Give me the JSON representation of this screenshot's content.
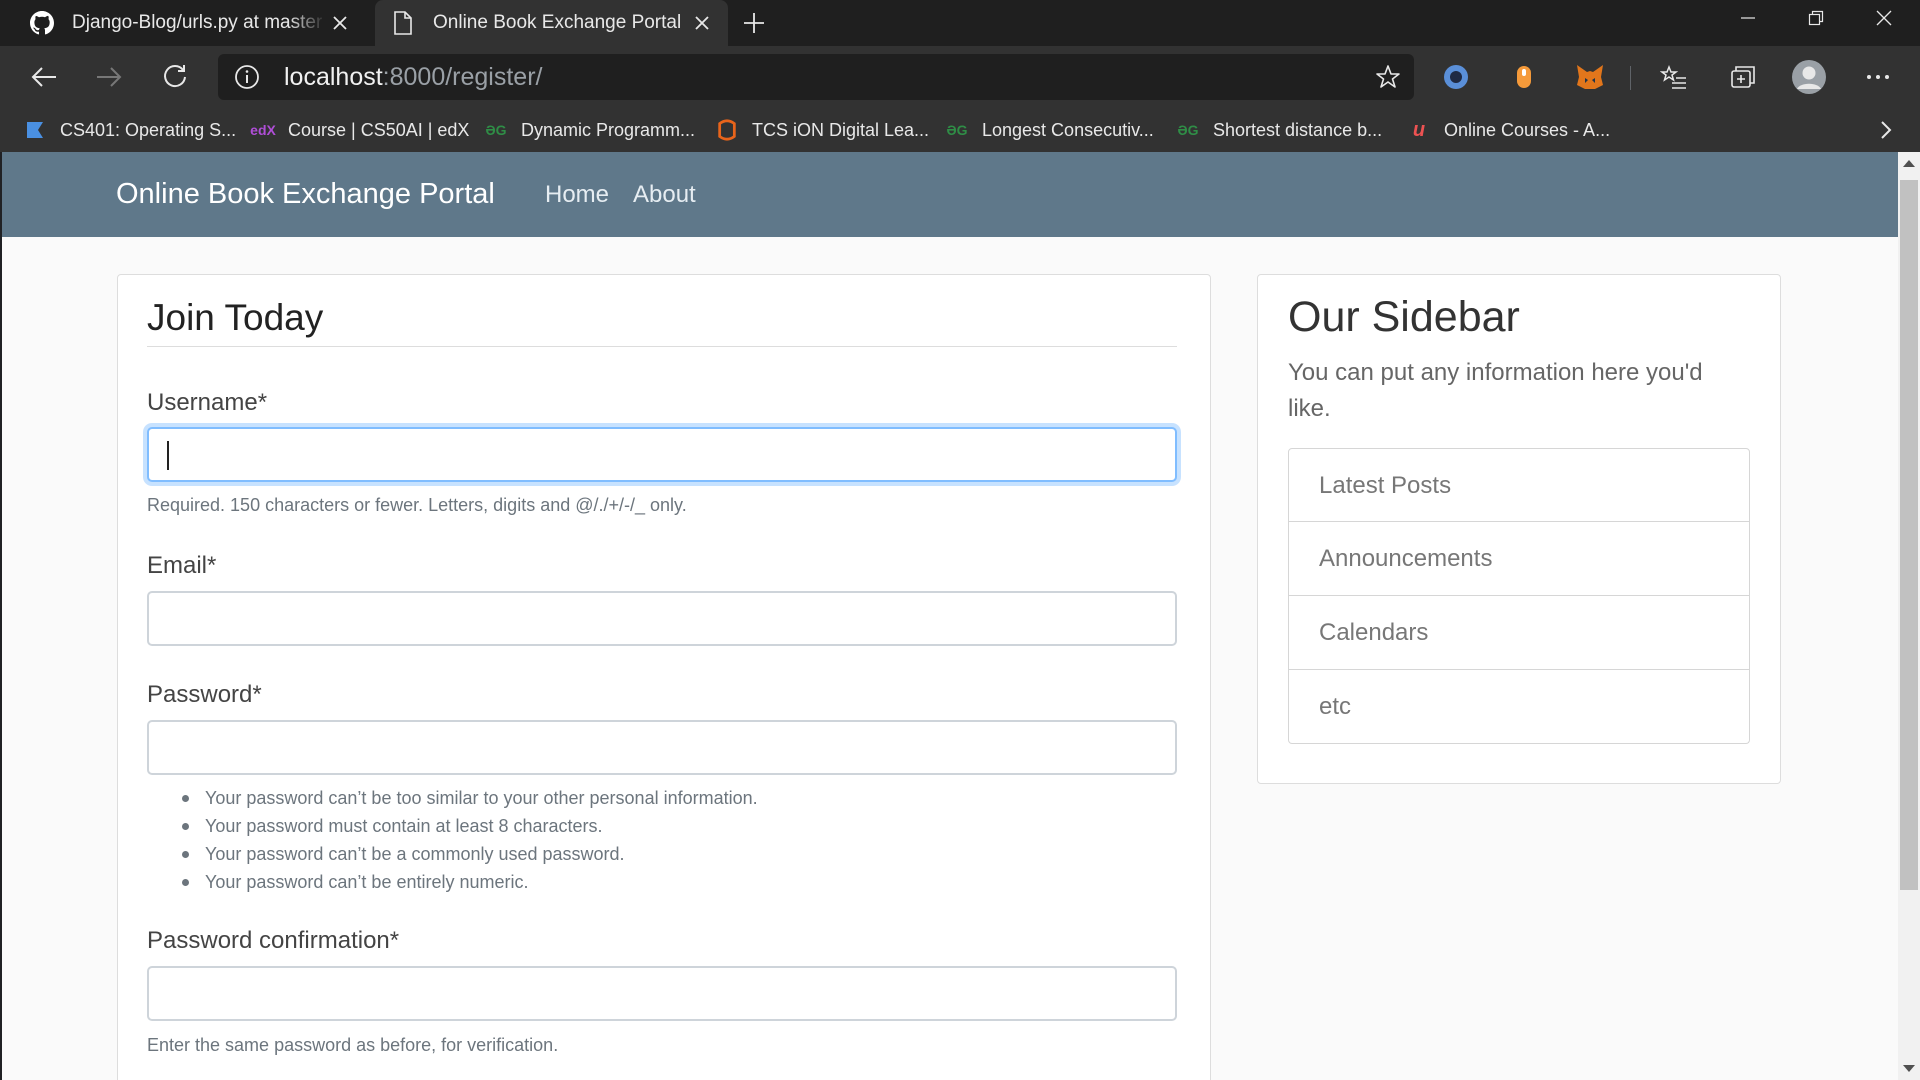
{
  "browser": {
    "tabs": [
      {
        "title": "Django-Blog/urls.py at master · u",
        "icon": "github-icon",
        "active": false
      },
      {
        "title": "Online Book Exchange Portal",
        "icon": "page-icon",
        "active": true
      }
    ],
    "address": {
      "host": "localhost",
      "path": ":8000/register/"
    },
    "bookmarks": [
      {
        "label": "CS401: Operating S...",
        "icon": "saylor-icon",
        "color": "#4a90e2"
      },
      {
        "label": "Course | CS50AI | edX",
        "icon": "edx-icon",
        "color": "#b04ed8",
        "glyph": "edX"
      },
      {
        "label": "Dynamic Programm...",
        "icon": "geeksforgeeks-icon",
        "color": "#2f8d46",
        "glyph": "ƏG"
      },
      {
        "label": "TCS iON Digital Lea...",
        "icon": "tcs-ion-icon",
        "color": "#e8641b"
      },
      {
        "label": "Longest Consecutiv...",
        "icon": "geeksforgeeks-icon",
        "color": "#2f8d46",
        "glyph": "ƏG"
      },
      {
        "label": "Shortest distance b...",
        "icon": "geeksforgeeks-icon",
        "color": "#2f8d46",
        "glyph": "ƏG"
      },
      {
        "label": "Online Courses - A...",
        "icon": "udemy-icon",
        "color": "#ec5252",
        "glyph": "u"
      }
    ]
  },
  "site": {
    "brand": "Online Book Exchange Portal",
    "nav": [
      "Home",
      "About"
    ],
    "navbar_color": "#5f788a"
  },
  "form": {
    "legend": "Join Today",
    "username": {
      "label": "Username*",
      "value": "",
      "help": "Required. 150 characters or fewer. Letters, digits and @/./+/-/_ only."
    },
    "email": {
      "label": "Email*",
      "value": ""
    },
    "password": {
      "label": "Password*",
      "value": "",
      "help": [
        "Your password can’t be too similar to your other personal information.",
        "Your password must contain at least 8 characters.",
        "Your password can’t be a commonly used password.",
        "Your password can’t be entirely numeric."
      ]
    },
    "password_confirmation": {
      "label": "Password confirmation*",
      "value": "",
      "help": "Enter the same password as before, for verification."
    }
  },
  "sidebar": {
    "title": "Our Sidebar",
    "description": "You can put any information here you'd like.",
    "items": [
      "Latest Posts",
      "Announcements",
      "Calendars",
      "etc"
    ]
  }
}
